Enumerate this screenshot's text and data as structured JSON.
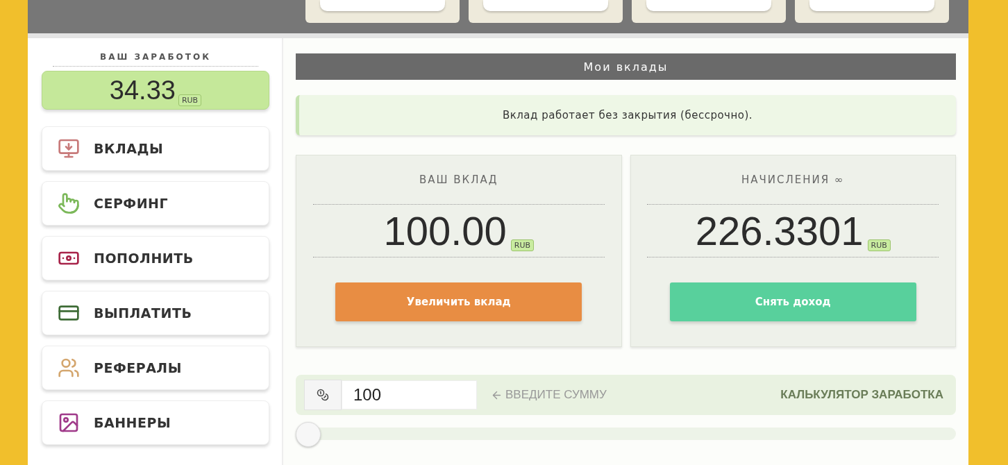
{
  "top_tabs": [
    {
      "selected": false
    },
    {
      "selected": false
    },
    {
      "selected": false
    },
    {
      "selected": false
    }
  ],
  "earnings": {
    "title": "ВАШ ЗАРАБОТОК",
    "amount": "34.33",
    "currency": "RUB"
  },
  "menu": [
    {
      "label": "ВКЛАДЫ"
    },
    {
      "label": "СЕРФИНГ"
    },
    {
      "label": "ПОПОЛНИТЬ"
    },
    {
      "label": "ВЫПЛАТИТЬ"
    },
    {
      "label": "РЕФЕРАЛЫ"
    },
    {
      "label": "БАННЕРЫ"
    }
  ],
  "section_title": "Мои вклады",
  "notice": "Вклад работает без закрытия (бессрочно).",
  "cards": [
    {
      "title": "ВАШ ВКЛАД",
      "amount": "100.00",
      "currency": "RUB",
      "button": "Увеличить вклад",
      "kind": "deposit"
    },
    {
      "title": "НАЧИСЛЕНИЯ ∞",
      "amount": "226.3301",
      "currency": "RUB",
      "button": "Снять доход",
      "kind": "withdraw"
    }
  ],
  "calculator": {
    "value": "100",
    "hint": "ВВЕДИТЕ СУММУ",
    "title": "КАЛЬКУЛЯТОР ЗАРАБОТКА",
    "slider": {
      "level": 0
    }
  }
}
